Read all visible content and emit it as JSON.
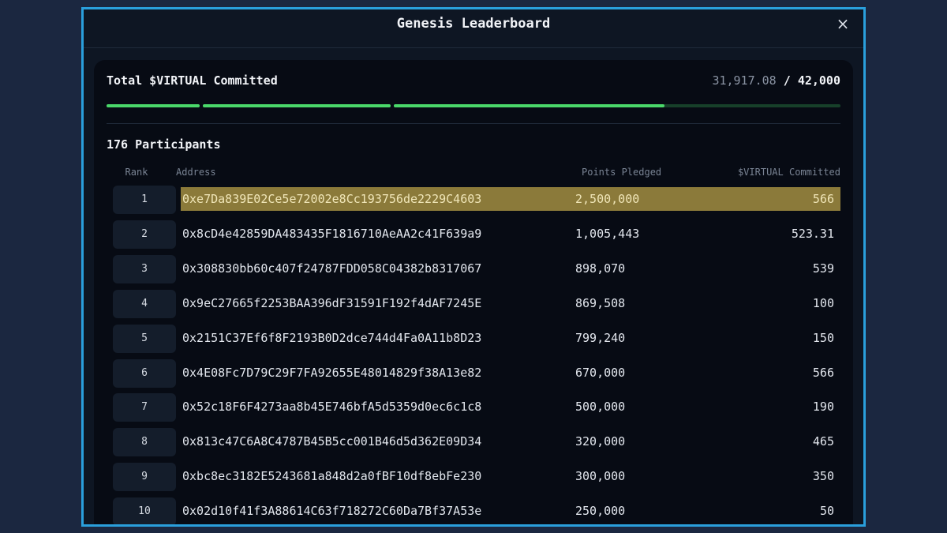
{
  "modal": {
    "title": "Genesis Leaderboard",
    "close_label": "×"
  },
  "summary": {
    "label": "Total $VIRTUAL Committed",
    "committed": "31,917.08",
    "separator": "/",
    "target": "42,000",
    "progress_fraction": 0.76,
    "colors": {
      "fill": "#4ad86a",
      "track": "#17402a",
      "highlight": "#8b7a3a",
      "frame": "#2a9fdc"
    }
  },
  "participants_label": "176 Participants",
  "table": {
    "headers": {
      "rank": "Rank",
      "address": "Address",
      "points": "Points Pledged",
      "virtual": "$VIRTUAL Committed"
    },
    "rows": [
      {
        "rank": "1",
        "address": "0xe7Da839E02Ce5e72002e8Cc193756de2229C4603",
        "points": "2,500,000",
        "virtual": "566",
        "highlighted": true
      },
      {
        "rank": "2",
        "address": "0x8cD4e42859DA483435F1816710AeAA2c41F639a9",
        "points": "1,005,443",
        "virtual": "523.31"
      },
      {
        "rank": "3",
        "address": "0x308830bb60c407f24787FDD058C04382b8317067",
        "points": "898,070",
        "virtual": "539"
      },
      {
        "rank": "4",
        "address": "0x9eC27665f2253BAA396dF31591F192f4dAF7245E",
        "points": "869,508",
        "virtual": "100"
      },
      {
        "rank": "5",
        "address": "0x2151C37Ef6f8F2193B0D2dce744d4Fa0A11b8D23",
        "points": "799,240",
        "virtual": "150"
      },
      {
        "rank": "6",
        "address": "0x4E08Fc7D79C29F7FA92655E48014829f38A13e82",
        "points": "670,000",
        "virtual": "566"
      },
      {
        "rank": "7",
        "address": "0x52c18F6F4273aa8b45E746bfA5d5359d0ec6c1c8",
        "points": "500,000",
        "virtual": "190"
      },
      {
        "rank": "8",
        "address": "0x813c47C6A8C4787B45B5cc001B46d5d362E09D34",
        "points": "320,000",
        "virtual": "465"
      },
      {
        "rank": "9",
        "address": "0xbc8ec3182E5243681a848d2a0fBF10df8ebFe230",
        "points": "300,000",
        "virtual": "350"
      },
      {
        "rank": "10",
        "address": "0x02d10f41f3A88614C63f718272C60Da7Bf37A53e",
        "points": "250,000",
        "virtual": "50"
      }
    ]
  }
}
